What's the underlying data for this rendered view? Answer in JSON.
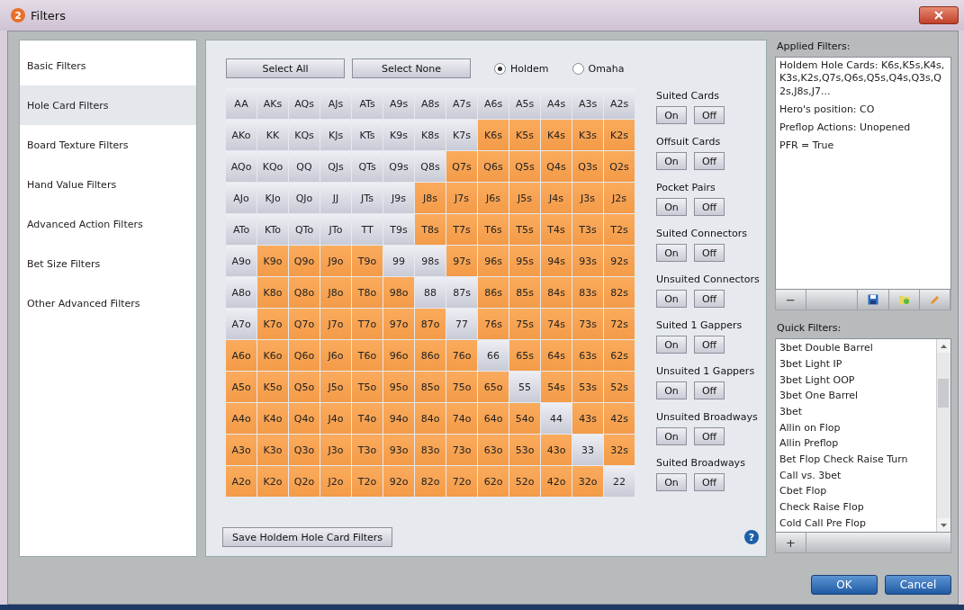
{
  "window": {
    "title": "Filters",
    "badge": "2"
  },
  "sidebar": {
    "items": [
      {
        "label": "Basic Filters",
        "selected": false
      },
      {
        "label": "Hole Card Filters",
        "selected": true
      },
      {
        "label": "Board Texture Filters",
        "selected": false
      },
      {
        "label": "Hand Value Filters",
        "selected": false
      },
      {
        "label": "Advanced Action Filters",
        "selected": false
      },
      {
        "label": "Bet Size Filters",
        "selected": false
      },
      {
        "label": "Other Advanced Filters",
        "selected": false
      }
    ]
  },
  "toolbar": {
    "buttons": [
      "Select All",
      "Select None"
    ],
    "game_options": [
      {
        "label": "Holdem",
        "selected": true
      },
      {
        "label": "Omaha",
        "selected": false
      }
    ]
  },
  "grid": {
    "rows": [
      [
        {
          "label": "AA",
          "selected": false
        },
        {
          "label": "AKs",
          "selected": false
        },
        {
          "label": "AQs",
          "selected": false
        },
        {
          "label": "AJs",
          "selected": false
        },
        {
          "label": "ATs",
          "selected": false
        },
        {
          "label": "A9s",
          "selected": false
        },
        {
          "label": "A8s",
          "selected": false
        },
        {
          "label": "A7s",
          "selected": false
        },
        {
          "label": "A6s",
          "selected": false
        },
        {
          "label": "A5s",
          "selected": false
        },
        {
          "label": "A4s",
          "selected": false
        },
        {
          "label": "A3s",
          "selected": false
        },
        {
          "label": "A2s",
          "selected": false
        }
      ],
      [
        {
          "label": "AKo",
          "selected": false
        },
        {
          "label": "KK",
          "selected": false
        },
        {
          "label": "KQs",
          "selected": false
        },
        {
          "label": "KJs",
          "selected": false
        },
        {
          "label": "KTs",
          "selected": false
        },
        {
          "label": "K9s",
          "selected": false
        },
        {
          "label": "K8s",
          "selected": false
        },
        {
          "label": "K7s",
          "selected": false
        },
        {
          "label": "K6s",
          "selected": true
        },
        {
          "label": "K5s",
          "selected": true
        },
        {
          "label": "K4s",
          "selected": true
        },
        {
          "label": "K3s",
          "selected": true
        },
        {
          "label": "K2s",
          "selected": true
        }
      ],
      [
        {
          "label": "AQo",
          "selected": false
        },
        {
          "label": "KQo",
          "selected": false
        },
        {
          "label": "QQ",
          "selected": false
        },
        {
          "label": "QJs",
          "selected": false
        },
        {
          "label": "QTs",
          "selected": false
        },
        {
          "label": "Q9s",
          "selected": false
        },
        {
          "label": "Q8s",
          "selected": false
        },
        {
          "label": "Q7s",
          "selected": true
        },
        {
          "label": "Q6s",
          "selected": true
        },
        {
          "label": "Q5s",
          "selected": true
        },
        {
          "label": "Q4s",
          "selected": true
        },
        {
          "label": "Q3s",
          "selected": true
        },
        {
          "label": "Q2s",
          "selected": true
        }
      ],
      [
        {
          "label": "AJo",
          "selected": false
        },
        {
          "label": "KJo",
          "selected": false
        },
        {
          "label": "QJo",
          "selected": false
        },
        {
          "label": "JJ",
          "selected": false
        },
        {
          "label": "JTs",
          "selected": false
        },
        {
          "label": "J9s",
          "selected": false
        },
        {
          "label": "J8s",
          "selected": true
        },
        {
          "label": "J7s",
          "selected": true
        },
        {
          "label": "J6s",
          "selected": true
        },
        {
          "label": "J5s",
          "selected": true
        },
        {
          "label": "J4s",
          "selected": true
        },
        {
          "label": "J3s",
          "selected": true
        },
        {
          "label": "J2s",
          "selected": true
        }
      ],
      [
        {
          "label": "ATo",
          "selected": false
        },
        {
          "label": "KTo",
          "selected": false
        },
        {
          "label": "QTo",
          "selected": false
        },
        {
          "label": "JTo",
          "selected": false
        },
        {
          "label": "TT",
          "selected": false
        },
        {
          "label": "T9s",
          "selected": false
        },
        {
          "label": "T8s",
          "selected": true
        },
        {
          "label": "T7s",
          "selected": true
        },
        {
          "label": "T6s",
          "selected": true
        },
        {
          "label": "T5s",
          "selected": true
        },
        {
          "label": "T4s",
          "selected": true
        },
        {
          "label": "T3s",
          "selected": true
        },
        {
          "label": "T2s",
          "selected": true
        }
      ],
      [
        {
          "label": "A9o",
          "selected": false
        },
        {
          "label": "K9o",
          "selected": true
        },
        {
          "label": "Q9o",
          "selected": true
        },
        {
          "label": "J9o",
          "selected": true
        },
        {
          "label": "T9o",
          "selected": true
        },
        {
          "label": "99",
          "selected": false
        },
        {
          "label": "98s",
          "selected": false
        },
        {
          "label": "97s",
          "selected": true
        },
        {
          "label": "96s",
          "selected": true
        },
        {
          "label": "95s",
          "selected": true
        },
        {
          "label": "94s",
          "selected": true
        },
        {
          "label": "93s",
          "selected": true
        },
        {
          "label": "92s",
          "selected": true
        }
      ],
      [
        {
          "label": "A8o",
          "selected": false
        },
        {
          "label": "K8o",
          "selected": true
        },
        {
          "label": "Q8o",
          "selected": true
        },
        {
          "label": "J8o",
          "selected": true
        },
        {
          "label": "T8o",
          "selected": true
        },
        {
          "label": "98o",
          "selected": true
        },
        {
          "label": "88",
          "selected": false
        },
        {
          "label": "87s",
          "selected": false
        },
        {
          "label": "86s",
          "selected": true
        },
        {
          "label": "85s",
          "selected": true
        },
        {
          "label": "84s",
          "selected": true
        },
        {
          "label": "83s",
          "selected": true
        },
        {
          "label": "82s",
          "selected": true
        }
      ],
      [
        {
          "label": "A7o",
          "selected": false
        },
        {
          "label": "K7o",
          "selected": true
        },
        {
          "label": "Q7o",
          "selected": true
        },
        {
          "label": "J7o",
          "selected": true
        },
        {
          "label": "T7o",
          "selected": true
        },
        {
          "label": "97o",
          "selected": true
        },
        {
          "label": "87o",
          "selected": true
        },
        {
          "label": "77",
          "selected": false
        },
        {
          "label": "76s",
          "selected": true
        },
        {
          "label": "75s",
          "selected": true
        },
        {
          "label": "74s",
          "selected": true
        },
        {
          "label": "73s",
          "selected": true
        },
        {
          "label": "72s",
          "selected": true
        }
      ],
      [
        {
          "label": "A6o",
          "selected": true
        },
        {
          "label": "K6o",
          "selected": true
        },
        {
          "label": "Q6o",
          "selected": true
        },
        {
          "label": "J6o",
          "selected": true
        },
        {
          "label": "T6o",
          "selected": true
        },
        {
          "label": "96o",
          "selected": true
        },
        {
          "label": "86o",
          "selected": true
        },
        {
          "label": "76o",
          "selected": true
        },
        {
          "label": "66",
          "selected": false
        },
        {
          "label": "65s",
          "selected": true
        },
        {
          "label": "64s",
          "selected": true
        },
        {
          "label": "63s",
          "selected": true
        },
        {
          "label": "62s",
          "selected": true
        }
      ],
      [
        {
          "label": "A5o",
          "selected": true
        },
        {
          "label": "K5o",
          "selected": true
        },
        {
          "label": "Q5o",
          "selected": true
        },
        {
          "label": "J5o",
          "selected": true
        },
        {
          "label": "T5o",
          "selected": true
        },
        {
          "label": "95o",
          "selected": true
        },
        {
          "label": "85o",
          "selected": true
        },
        {
          "label": "75o",
          "selected": true
        },
        {
          "label": "65o",
          "selected": true
        },
        {
          "label": "55",
          "selected": false
        },
        {
          "label": "54s",
          "selected": true
        },
        {
          "label": "53s",
          "selected": true
        },
        {
          "label": "52s",
          "selected": true
        }
      ],
      [
        {
          "label": "A4o",
          "selected": true
        },
        {
          "label": "K4o",
          "selected": true
        },
        {
          "label": "Q4o",
          "selected": true
        },
        {
          "label": "J4o",
          "selected": true
        },
        {
          "label": "T4o",
          "selected": true
        },
        {
          "label": "94o",
          "selected": true
        },
        {
          "label": "84o",
          "selected": true
        },
        {
          "label": "74o",
          "selected": true
        },
        {
          "label": "64o",
          "selected": true
        },
        {
          "label": "54o",
          "selected": true
        },
        {
          "label": "44",
          "selected": false
        },
        {
          "label": "43s",
          "selected": true
        },
        {
          "label": "42s",
          "selected": true
        }
      ],
      [
        {
          "label": "A3o",
          "selected": true
        },
        {
          "label": "K3o",
          "selected": true
        },
        {
          "label": "Q3o",
          "selected": true
        },
        {
          "label": "J3o",
          "selected": true
        },
        {
          "label": "T3o",
          "selected": true
        },
        {
          "label": "93o",
          "selected": true
        },
        {
          "label": "83o",
          "selected": true
        },
        {
          "label": "73o",
          "selected": true
        },
        {
          "label": "63o",
          "selected": true
        },
        {
          "label": "53o",
          "selected": true
        },
        {
          "label": "43o",
          "selected": true
        },
        {
          "label": "33",
          "selected": false
        },
        {
          "label": "32s",
          "selected": true
        }
      ],
      [
        {
          "label": "A2o",
          "selected": true
        },
        {
          "label": "K2o",
          "selected": true
        },
        {
          "label": "Q2o",
          "selected": true
        },
        {
          "label": "J2o",
          "selected": true
        },
        {
          "label": "T2o",
          "selected": true
        },
        {
          "label": "92o",
          "selected": true
        },
        {
          "label": "82o",
          "selected": true
        },
        {
          "label": "72o",
          "selected": true
        },
        {
          "label": "62o",
          "selected": true
        },
        {
          "label": "52o",
          "selected": true
        },
        {
          "label": "42o",
          "selected": true
        },
        {
          "label": "32o",
          "selected": true
        },
        {
          "label": "22",
          "selected": false
        }
      ]
    ]
  },
  "filter_groups": [
    {
      "label": "Suited Cards",
      "buttons": [
        "On",
        "Off"
      ]
    },
    {
      "label": "Offsuit Cards",
      "buttons": [
        "On",
        "Off"
      ]
    },
    {
      "label": "Pocket Pairs",
      "buttons": [
        "On",
        "Off"
      ]
    },
    {
      "label": "Suited Connectors",
      "buttons": [
        "On",
        "Off"
      ]
    },
    {
      "label": "Unsuited Connectors",
      "buttons": [
        "On",
        "Off"
      ]
    },
    {
      "label": "Suited 1 Gappers",
      "buttons": [
        "On",
        "Off"
      ]
    },
    {
      "label": "Unsuited 1 Gappers",
      "buttons": [
        "On",
        "Off"
      ]
    },
    {
      "label": "Unsuited Broadways",
      "buttons": [
        "On",
        "Off"
      ]
    },
    {
      "label": "Suited Broadways",
      "buttons": [
        "On",
        "Off"
      ]
    }
  ],
  "save_button": "Save Holdem Hole Card Filters",
  "help_icon": "?",
  "applied_filters": {
    "title": "Applied Filters:",
    "items": [
      "Holdem Hole Cards: K6s,K5s,K4s,K3s,K2s,Q7s,Q6s,Q5s,Q4s,Q3s,Q2s,J8s,J7...",
      "Hero's position: CO",
      "Preflop Actions: Unopened",
      "PFR = True"
    ],
    "remove_button": "−"
  },
  "quick_filters": {
    "title": "Quick Filters:",
    "items": [
      "3bet Double Barrel",
      "3bet Light IP",
      "3bet Light OOP",
      "3bet One Barrel",
      "3bet",
      "Allin on Flop",
      "Allin Preflop",
      "Bet Flop Check Raise Turn",
      "Call vs. 3bet",
      "Cbet Flop",
      "Check Raise Flop",
      "Cold Call Pre Flop"
    ],
    "add_button": "+"
  },
  "dialog_buttons": [
    "OK",
    "Cancel"
  ]
}
